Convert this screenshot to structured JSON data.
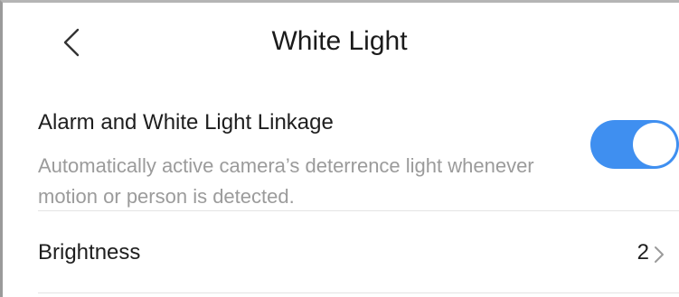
{
  "header": {
    "back_icon": "chevron-left-icon",
    "title": "White Light"
  },
  "alarm_linkage": {
    "title": "Alarm and White Light Linkage",
    "description": "Automatically active camera’s deterrence light whenever motion or person is detected.",
    "enabled": true,
    "toggle_color": "#3f8ff0"
  },
  "brightness": {
    "label": "Brightness",
    "value": "2",
    "chevron_icon": "chevron-right-icon"
  }
}
